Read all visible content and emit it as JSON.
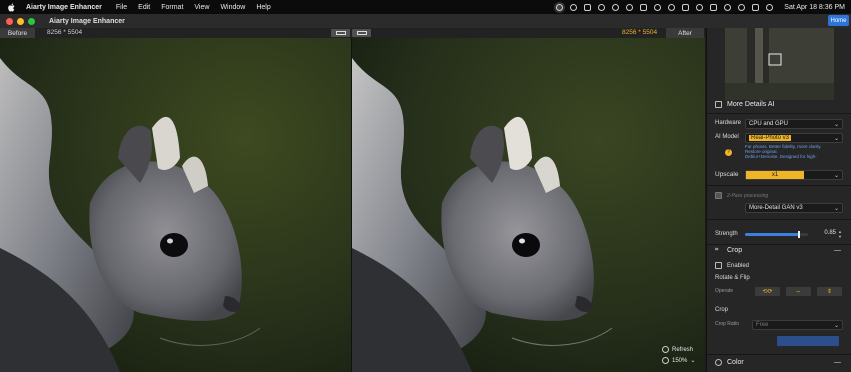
{
  "menubar": {
    "app_name": "Aiarty Image Enhancer",
    "menus": [
      "File",
      "Edit",
      "Format",
      "View",
      "Window",
      "Help"
    ],
    "clock": "Sat Apr 18  8:36 PM"
  },
  "window": {
    "title": "Aiarty Image Enhancer",
    "home_label": "Home"
  },
  "compare": {
    "before_label": "Before",
    "after_label": "After",
    "dimensions_before": "8256 * 5504",
    "dimensions_after": "8256 * 5504",
    "dimensions_after_color": "#f0b429"
  },
  "viewer": {
    "refresh_label": "Refresh",
    "zoom": "150%"
  },
  "panel": {
    "more_details": "More Details AI",
    "hardware_label": "Hardware",
    "hardware_value": "CPU and GPU",
    "ai_model_label": "AI Model",
    "ai_model_value": "Real-Photo  v3",
    "ai_model_desc_1": "For photos. Better fidelity, more clarity.",
    "ai_model_desc_2": "Restore original.",
    "ai_model_desc_3": "Deblur+Denoise. Designed for high-",
    "upscale_label": "Upscale",
    "upscale_value": "x1",
    "two_pass_label": "2-Pass processing",
    "two_pass_model": "More-Detail GAN  v3",
    "strength_label": "Strength",
    "strength_value": "0.85",
    "strength_fraction": 0.85,
    "crop_title": "Crop",
    "enabled_label": "Enabled",
    "rotate_flip_label": "Rotate & Flip",
    "operate_label": "Operate",
    "crop_sub_label": "Crop",
    "crop_ratio_label": "Crop Ratio",
    "crop_ratio_value": "Free",
    "color_title": "Color",
    "accent": "#f0b429",
    "home_blue": "#2d74d8"
  }
}
